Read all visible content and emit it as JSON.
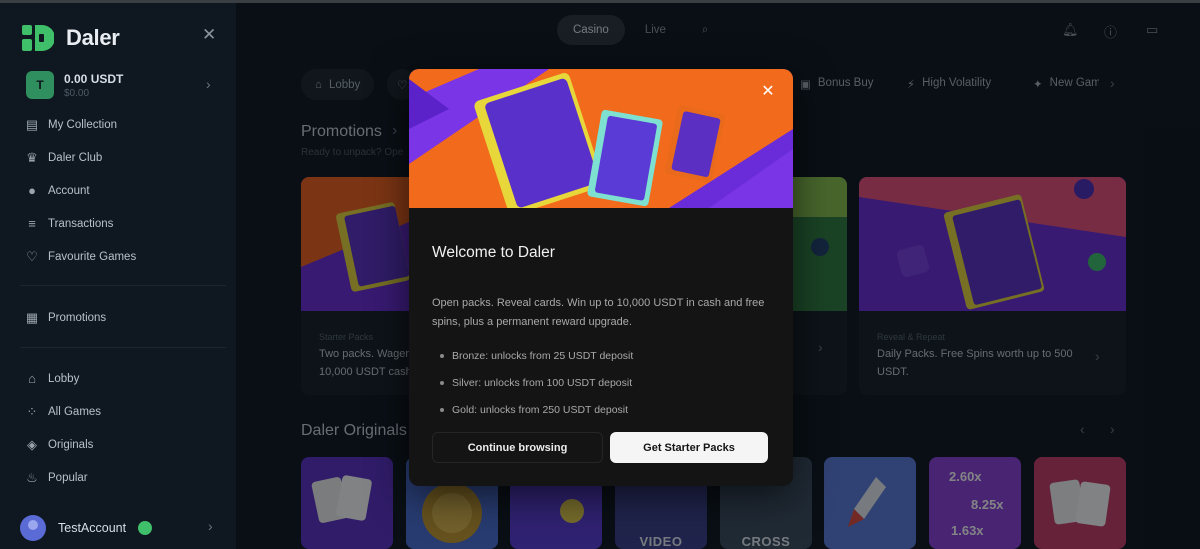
{
  "app": {
    "name": "Daler"
  },
  "wallet": {
    "amount": "0.00 USDT",
    "sub": "$0.00",
    "icon_letter": "T"
  },
  "sidebar": {
    "account_items": [
      {
        "label": "My Collection",
        "icon": "collection-icon"
      },
      {
        "label": "Daler Club",
        "icon": "club-icon"
      },
      {
        "label": "Account",
        "icon": "user-icon"
      },
      {
        "label": "Transactions",
        "icon": "list-icon"
      },
      {
        "label": "Favourite Games",
        "icon": "heart-icon"
      }
    ],
    "promo_item": {
      "label": "Promotions",
      "icon": "promo-icon"
    },
    "game_items": [
      {
        "label": "Lobby",
        "icon": "home-icon"
      },
      {
        "label": "All Games",
        "icon": "grid-icon"
      },
      {
        "label": "Originals",
        "icon": "originals-icon"
      },
      {
        "label": "Popular",
        "icon": "fire-icon"
      }
    ],
    "user_name": "TestAccount"
  },
  "topbar": {
    "tabs": [
      "Casino",
      "Live"
    ],
    "active_tab": "Casino"
  },
  "categories": {
    "lobby": "Lobby",
    "bonus_buy": "Bonus Buy",
    "high_volatility": "High Volatility",
    "new_games": "New Gam"
  },
  "promotions": {
    "title": "Promotions",
    "subtitle": "Ready to unpack? Ope",
    "card1": {
      "tag": "Starter Packs",
      "title": "Two packs. Wager",
      "title2": "10,000 USDT cash"
    },
    "card3": {
      "tag": "Reveal & Repeat",
      "title": "Daily Packs. Free Spins worth up to 500",
      "title2": "USDT."
    }
  },
  "originals": {
    "title": "Daler Originals",
    "games": [
      "VIDEO",
      "CROSS"
    ],
    "multipliers": [
      "2.60x",
      "8.25x",
      "1.63x"
    ]
  },
  "modal": {
    "title": "Welcome to Daler",
    "description": "Open packs. Reveal cards. Win up to 10,000 USDT in cash and free spins, plus a permanent reward upgrade.",
    "bullets": [
      "Bronze: unlocks from 25 USDT deposit",
      "Silver: unlocks from 100 USDT deposit",
      "Gold: unlocks from 250 USDT deposit"
    ],
    "secondary_button": "Continue browsing",
    "primary_button": "Get Starter Packs"
  },
  "colors": {
    "brand_green": "#3fbf6a",
    "background": "#0d141c",
    "modal_bg": "#141414",
    "hero_purple": "#6a2bd9",
    "hero_orange": "#f26a1b"
  }
}
